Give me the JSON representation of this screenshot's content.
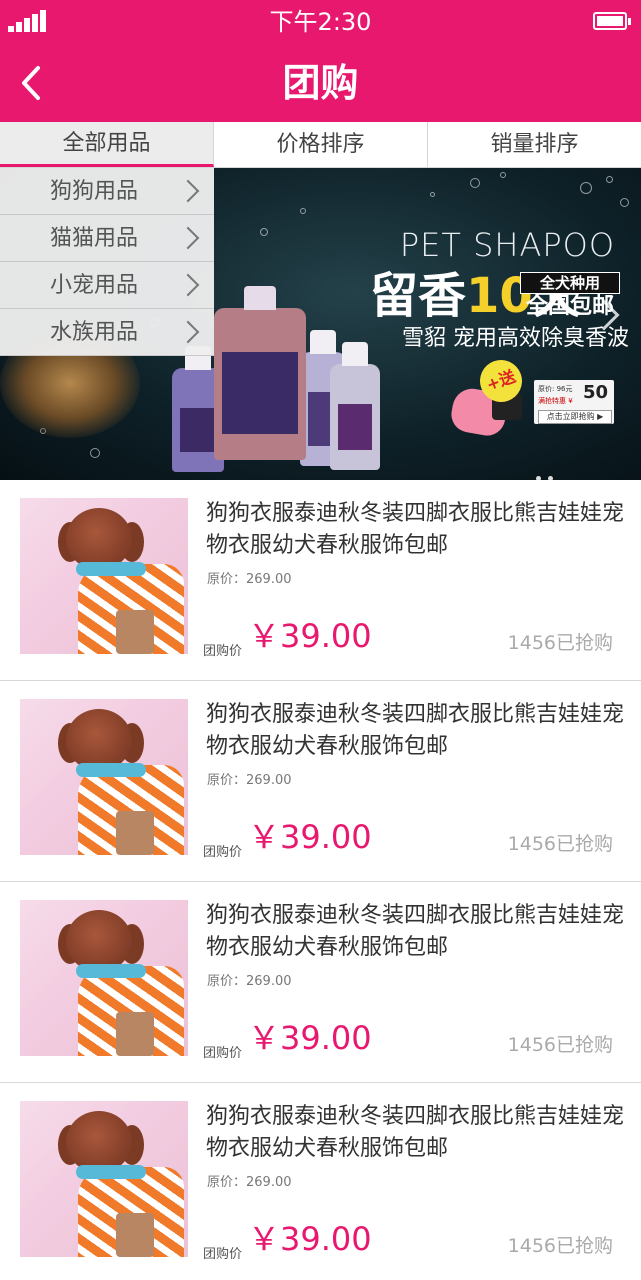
{
  "status_bar": {
    "time": "下午2:30"
  },
  "header": {
    "title": "团购"
  },
  "tabs": [
    {
      "label": "全部用品"
    },
    {
      "label": "价格排序"
    },
    {
      "label": "销量排序"
    }
  ],
  "categories": [
    {
      "label": "狗狗用品"
    },
    {
      "label": "猫猫用品"
    },
    {
      "label": "小宠用品"
    },
    {
      "label": "水族用品"
    }
  ],
  "banner": {
    "title_en": "PET SHAPOO",
    "headline_a": "留香",
    "headline_num": "10",
    "headline_b": "天",
    "tag_top": "全犬种用",
    "tag_bottom": "全国包邮",
    "subtitle": "雪貂 宠用高效除臭香波",
    "gift": "+送",
    "promo_original": "原价: 96元",
    "promo_special": "满抢特惠 ¥",
    "promo_price": "50",
    "promo_button": "点击立即抢购 ▶"
  },
  "products": [
    {
      "title": "狗狗衣服泰迪秋冬装四脚衣服比熊吉娃娃宠物衣服幼犬春秋服饰包邮",
      "original": "原价：269.00",
      "price_label": "团购价",
      "price": "￥39.00",
      "sold": "1456已抢购"
    },
    {
      "title": "狗狗衣服泰迪秋冬装四脚衣服比熊吉娃娃宠物衣服幼犬春秋服饰包邮",
      "original": "原价：269.00",
      "price_label": "团购价",
      "price": "￥39.00",
      "sold": "1456已抢购"
    },
    {
      "title": "狗狗衣服泰迪秋冬装四脚衣服比熊吉娃娃宠物衣服幼犬春秋服饰包邮",
      "original": "原价：269.00",
      "price_label": "团购价",
      "price": "￥39.00",
      "sold": "1456已抢购"
    },
    {
      "title": "狗狗衣服泰迪秋冬装四脚衣服比熊吉娃娃宠物衣服幼犬春秋服饰包邮",
      "original": "原价：269.00",
      "price_label": "团购价",
      "price": "￥39.00",
      "sold": "1456已抢购"
    }
  ],
  "colors": {
    "accent": "#e8186f",
    "banner_bg": "#0e2128",
    "price": "#e8186f"
  },
  "icons": [
    "signal-icon",
    "battery-icon",
    "back-arrow-icon",
    "chevron-right-icon",
    "banner-next-icon"
  ]
}
